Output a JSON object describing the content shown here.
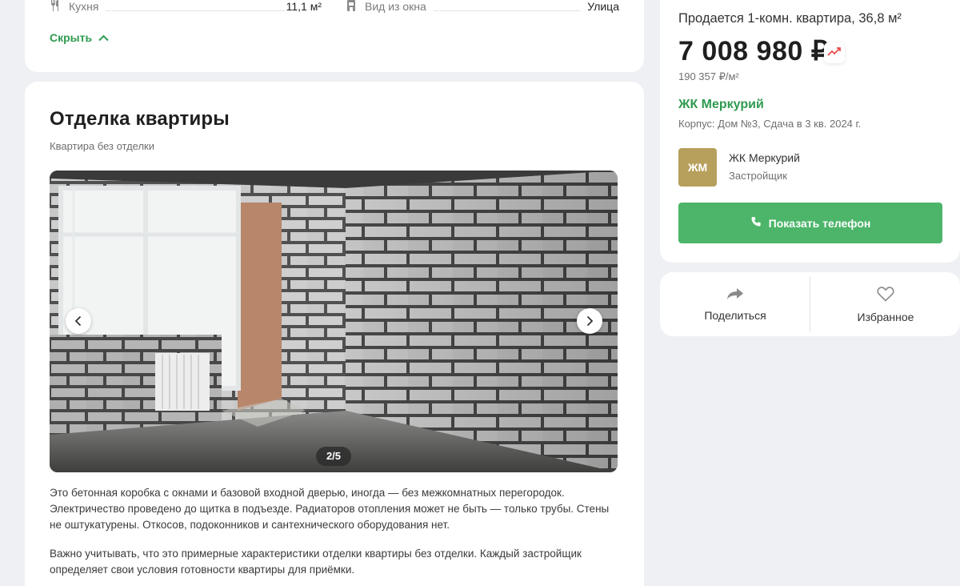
{
  "specs": {
    "kitchen_label": "Кухня",
    "kitchen_value": "11,1 м²",
    "view_label": "Вид из окна",
    "view_value": "Улица"
  },
  "hide_link": "Скрыть",
  "finish": {
    "title": "Отделка квартиры",
    "subtitle": "Квартира без отделки",
    "counter": "2/5",
    "paragraph1": "Это бетонная коробка с окнами и базовой входной дверью, иногда — без межкомнатных перегородок. Электричество проведено до щитка в подъезде. Радиаторов отопления может не быть — только трубы. Стены не оштукатурены. Откосов, подоконников и сантехнического оборудования нет.",
    "paragraph2": "Важно учитывать, что это примерные характеристики отделки квартиры без отделки. Каждый застройщик определяет свои условия готовности квартиры для приёмки."
  },
  "listing": {
    "title": "Продается 1-комн. квартира, 36,8 м²",
    "price": "7 008 980 ₽",
    "price_per_m": "190 357 ₽/м²",
    "complex_name": "ЖК Меркурий",
    "complex_info": "Корпус: Дом №3, Сдача в 3 кв. 2024 г."
  },
  "developer": {
    "logo_text": "ЖМ",
    "name": "ЖК Меркурий",
    "role": "Застройщик"
  },
  "phone_button": "Показать телефон",
  "actions": {
    "share": "Поделиться",
    "favorite": "Избранное"
  },
  "colors": {
    "accent": "#2e9b4f",
    "button": "#4cb56a",
    "trend": "#e84b4b",
    "logo_bg": "#b79f5c"
  }
}
